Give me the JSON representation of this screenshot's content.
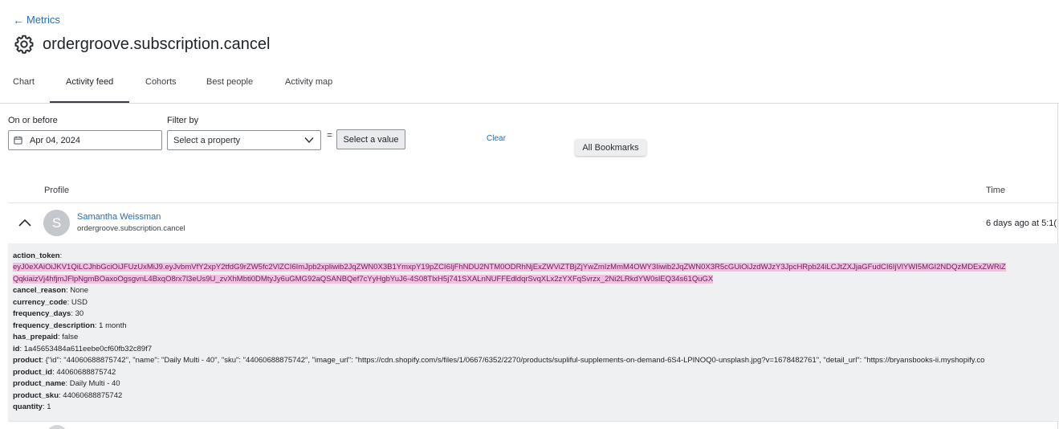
{
  "nav": {
    "back_label": "Metrics"
  },
  "header": {
    "title": "ordergroove.subscription.cancel"
  },
  "tabs": [
    {
      "label": "Chart"
    },
    {
      "label": "Activity feed"
    },
    {
      "label": "Cohorts"
    },
    {
      "label": "Best people"
    },
    {
      "label": "Activity map"
    }
  ],
  "active_tab": "Activity feed",
  "filters": {
    "date_label": "On or before",
    "date_value": "Apr 04, 2024",
    "filter_label": "Filter by",
    "property_placeholder": "Select a property",
    "equals": "=",
    "value_button": "Select a value",
    "clear": "Clear",
    "bookmarks": "All Bookmarks"
  },
  "table": {
    "profile_header": "Profile",
    "time_header": "Time",
    "row": {
      "avatar_initial": "S",
      "name": "Samantha Weissman",
      "event": "ordergroove.subscription.cancel",
      "time": "6 days ago at 5:1("
    }
  },
  "details": {
    "action_token_key": "action_token",
    "action_token_line1": "eyJ0eXAiOiJKV1QiLCJhbGciOiJFUzUxMiJ9.eyJvbmVfY2xpY2tfdG9rZW5fc2VlZCI6ImJpb2xpliwib2JqZWN0X3B1YmxpY19pZCI6IjFhNDU2NTM0ODRhNjExZWViZTBjZjYwZmIzMmM4OWY3Iiwib2JqZWN0X3R5cGUiOiJzdWJzY3JpcHRpb24iLCJtZXJjaGFudCI6IjVlYWI5MGI2NDQzMDExZWRiZ",
    "action_token_line2": "QqkiaizVj4hfjmJFlpNgmBOaxoOgsgvnL4BxqO8rx7l3eUs9U_zvXhMbti0DMtyJy6uGMG92aQSANBQef7cYyHgbYuJ6-4S08TlxH5j741SXALnNUFFEdldqrSvqXLx2zYXFqSvrzx_2Ni2LRkdYW0slEQ34s61QuGX",
    "props": [
      {
        "key": "cancel_reason",
        "value": "None"
      },
      {
        "key": "currency_code",
        "value": "USD"
      },
      {
        "key": "frequency_days",
        "value": "30"
      },
      {
        "key": "frequency_description",
        "value": "1 month"
      },
      {
        "key": "has_prepaid",
        "value": "false"
      },
      {
        "key": "id",
        "value": "1a45653484a611eebe0cf60fb32c89f7"
      },
      {
        "key": "product",
        "value": "{\"id\": \"44060688875742\", \"name\": \"Daily Multi - 40\", \"sku\": \"44060688875742\", \"image_url\": \"https://cdn.shopify.com/s/files/1/0667/6352/2270/products/supliful-supplements-on-demand-6S4-LPlNOQ0-unsplash.jpg?v=1678482761\", \"detail_url\": \"https://bryansbooks-ii.myshopify.co"
      },
      {
        "key": "product_id",
        "value": "44060688875742"
      },
      {
        "key": "product_name",
        "value": "Daily Multi - 40"
      },
      {
        "key": "product_sku",
        "value": "44060688875742"
      },
      {
        "key": "quantity",
        "value": "1"
      }
    ]
  },
  "colors": {
    "link": "#2b6cb0",
    "token_highlight": "#f1bfe0",
    "detail_bg": "#eef0f2"
  }
}
